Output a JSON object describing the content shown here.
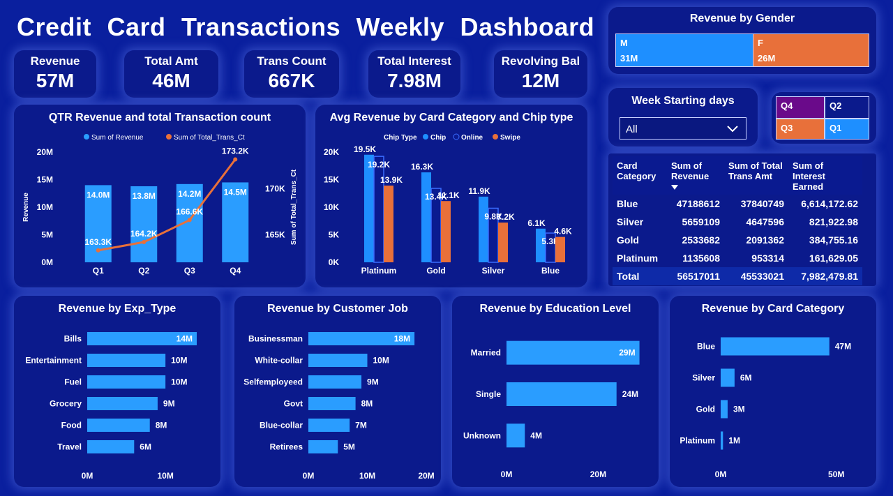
{
  "header": {
    "title": "Credit Card Transactions Weekly Dashboard"
  },
  "kpis": [
    {
      "label": "Revenue",
      "value": "57M"
    },
    {
      "label": "Total Amt",
      "value": "46M"
    },
    {
      "label": "Trans Count",
      "value": "667K"
    },
    {
      "label": "Total Interest",
      "value": "7.98M"
    },
    {
      "label": "Revolving Bal",
      "value": "12M"
    }
  ],
  "gender": {
    "title": "Revenue by Gender",
    "segments": [
      {
        "name": "M",
        "value": 31,
        "value_label": "31M",
        "color": "#1e8fff"
      },
      {
        "name": "F",
        "value": 26,
        "value_label": "26M",
        "color": "#e8703a"
      }
    ]
  },
  "slicer": {
    "title": "Week Starting days",
    "selected": "All"
  },
  "quarters": {
    "q4": "Q4",
    "q2": "Q2",
    "q3": "Q3",
    "q1": "Q1"
  },
  "matrix": {
    "headers": [
      "Card Category",
      "Sum of Revenue",
      "Sum of Total Trans Amt",
      "Sum of Interest Earned"
    ],
    "rows": [
      [
        "Blue",
        "47188612",
        "37840749",
        "6,614,172.62"
      ],
      [
        "Silver",
        "5659109",
        "4647596",
        "821,922.98"
      ],
      [
        "Gold",
        "2533682",
        "2091362",
        "384,755.16"
      ],
      [
        "Platinum",
        "1135608",
        "953314",
        "161,629.05"
      ]
    ],
    "total": [
      "Total",
      "56517011",
      "45533021",
      "7,982,479.81"
    ]
  },
  "colors": {
    "bar": "#2a9dff",
    "line": "#e8703a",
    "chip": "#1e8fff",
    "online": "#0a1a90",
    "swipe": "#e8703a"
  },
  "chart_data": [
    {
      "id": "qtr",
      "type": "bar",
      "title": "QTR Revenue and total Transaction count",
      "legend": [
        "Sum of Revenue",
        "Sum of Total_Trans_Ct"
      ],
      "categories": [
        "Q1",
        "Q2",
        "Q3",
        "Q4"
      ],
      "series": [
        {
          "name": "Sum of Revenue",
          "values": [
            14.0,
            13.8,
            14.2,
            14.5
          ],
          "labels": [
            "14.0M",
            "13.8M",
            "14.2M",
            "14.5M"
          ]
        },
        {
          "name": "Sum of Total_Trans_Ct",
          "type": "line",
          "values": [
            163.3,
            164.2,
            166.6,
            173.2
          ],
          "labels": [
            "163.3K",
            "164.2K",
            "166.6K",
            "173.2K"
          ]
        }
      ],
      "ylabel": "Revenue",
      "y2label": "Sum of Total_Trans_Ct",
      "ylim": [
        0,
        20
      ],
      "yticks": [
        "0M",
        "5M",
        "10M",
        "15M",
        "20M"
      ],
      "y2lim": [
        162,
        174
      ],
      "y2ticks": [
        "165K",
        "170K"
      ]
    },
    {
      "id": "chip",
      "type": "bar",
      "title": "Avg Revenue by Card Category and Chip type",
      "legend_title": "Chip Type",
      "legend": [
        "Chip",
        "Online",
        "Swipe"
      ],
      "categories": [
        "Platinum",
        "Gold",
        "Silver",
        "Blue"
      ],
      "series": [
        {
          "name": "Chip",
          "values": [
            19.5,
            16.3,
            11.9,
            6.1
          ],
          "labels": [
            "19.5K",
            "16.3K",
            "11.9K",
            "6.1K"
          ]
        },
        {
          "name": "Online",
          "values": [
            19.2,
            13.4,
            9.8,
            5.3
          ],
          "labels": [
            "19.2K",
            "13.4K",
            "9.8K",
            "5.3K"
          ]
        },
        {
          "name": "Swipe",
          "values": [
            13.9,
            11.1,
            7.2,
            4.6
          ],
          "labels": [
            "13.9K",
            "11.1K",
            "7.2K",
            "4.6K"
          ]
        }
      ],
      "ylim": [
        0,
        22
      ],
      "yticks": [
        "0K",
        "5K",
        "10K",
        "15K",
        "20K"
      ]
    },
    {
      "id": "exp",
      "type": "bar",
      "orientation": "horizontal",
      "title": "Revenue by Exp_Type",
      "categories": [
        "Bills",
        "Entertainment",
        "Fuel",
        "Grocery",
        "Food",
        "Travel"
      ],
      "values": [
        14,
        10,
        10,
        9,
        8,
        6
      ],
      "labels": [
        "14M",
        "10M",
        "10M",
        "9M",
        "8M",
        "6M"
      ],
      "xlim": [
        0,
        14
      ],
      "xticks": [
        "0M",
        "10M"
      ]
    },
    {
      "id": "job",
      "type": "bar",
      "orientation": "horizontal",
      "title": "Revenue by Customer Job",
      "categories": [
        "Businessman",
        "White-collar",
        "Selfemployeed",
        "Govt",
        "Blue-collar",
        "Retirees"
      ],
      "values": [
        18,
        10,
        9,
        8,
        7,
        5
      ],
      "labels": [
        "18M",
        "10M",
        "9M",
        "8M",
        "7M",
        "5M"
      ],
      "xlim": [
        0,
        20
      ],
      "xticks": [
        "0M",
        "10M",
        "20M"
      ]
    },
    {
      "id": "edu",
      "type": "bar",
      "orientation": "horizontal",
      "title": "Revenue by Education Level",
      "categories": [
        "Married",
        "Single",
        "Unknown"
      ],
      "values": [
        29,
        24,
        4
      ],
      "labels": [
        "29M",
        "24M",
        "4M"
      ],
      "xlim": [
        0,
        28
      ],
      "xticks": [
        "0M",
        "20M"
      ]
    },
    {
      "id": "card",
      "type": "bar",
      "orientation": "horizontal",
      "title": "Revenue by Card Category",
      "categories": [
        "Blue",
        "Silver",
        "Gold",
        "Platinum"
      ],
      "values": [
        47,
        6,
        3,
        1
      ],
      "labels": [
        "47M",
        "6M",
        "3M",
        "1M"
      ],
      "xlim": [
        0,
        51
      ],
      "xticks": [
        "0M",
        "50M"
      ]
    }
  ]
}
